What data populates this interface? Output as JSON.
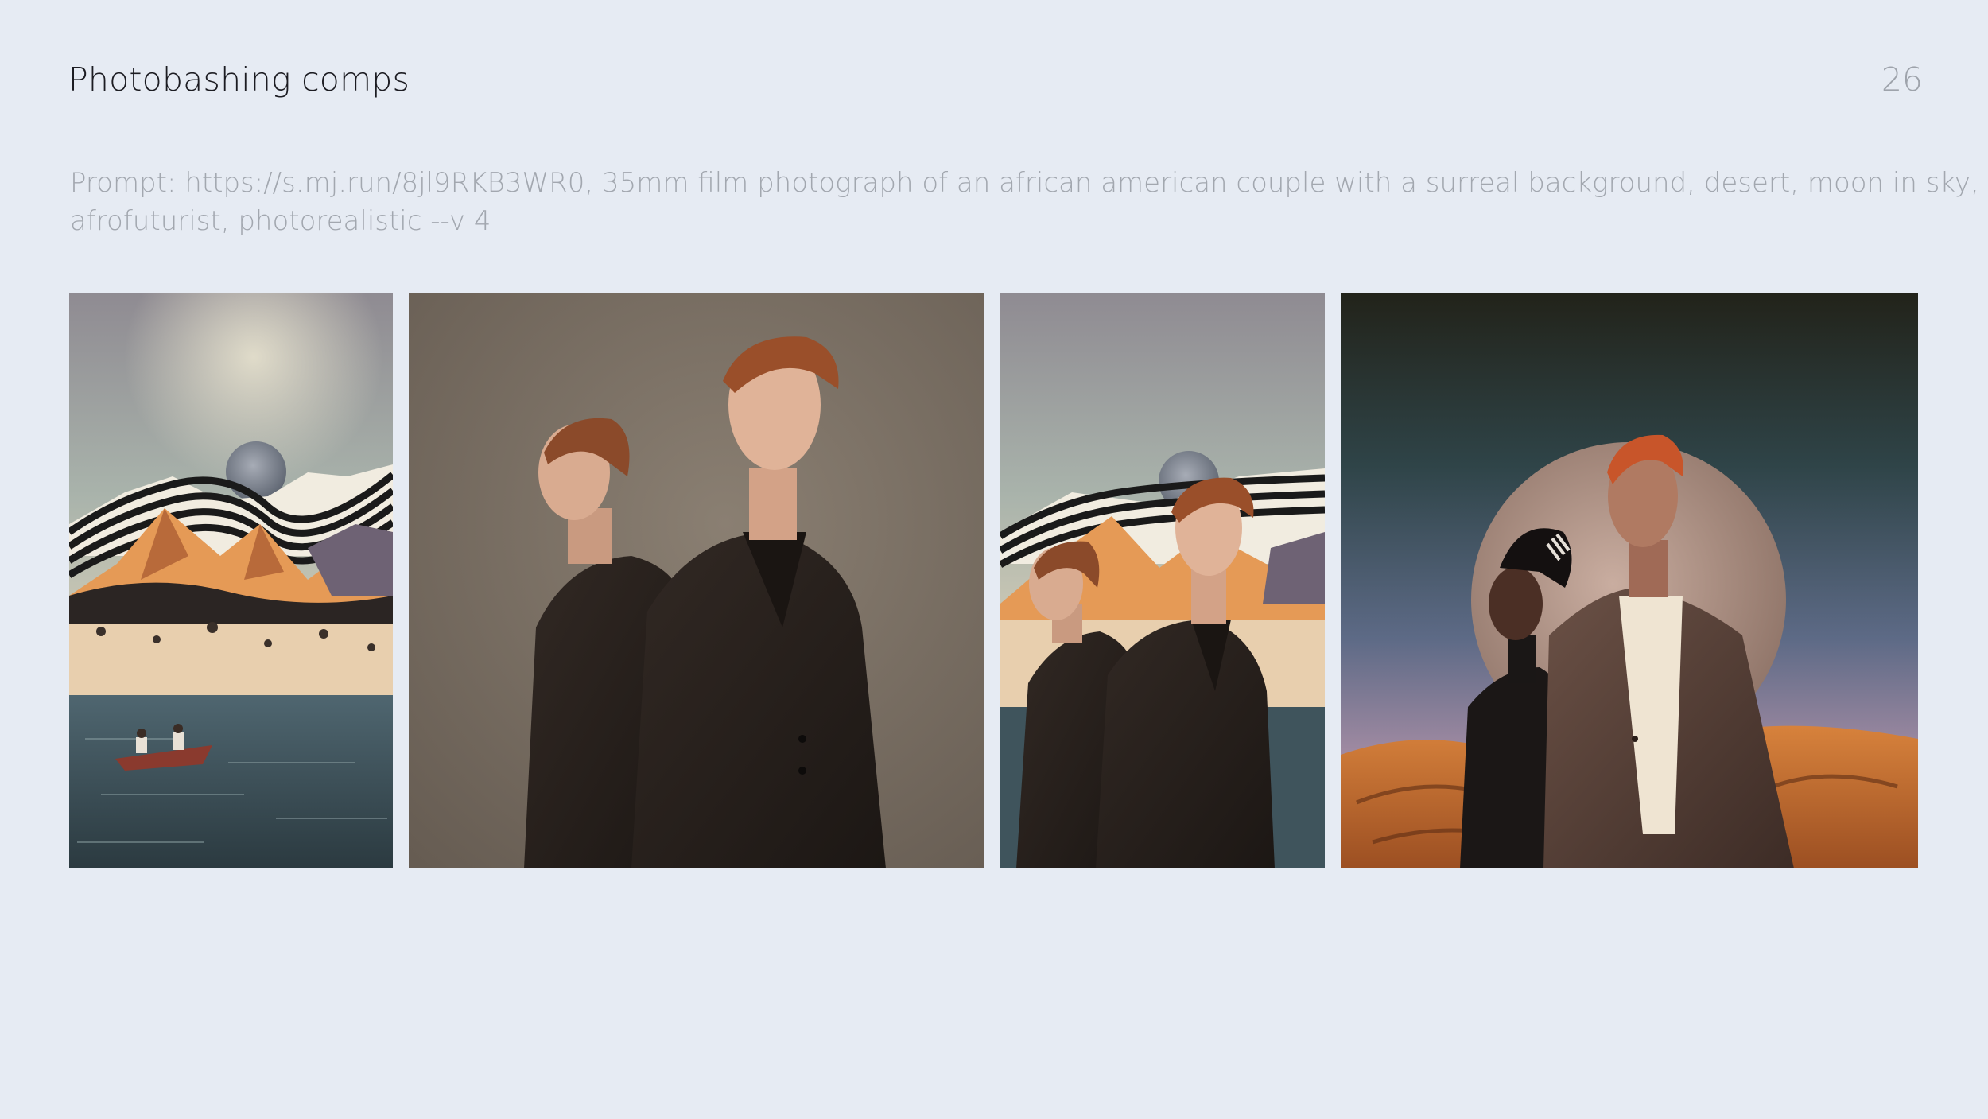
{
  "slide": {
    "title": "Photobashing comps",
    "page_number": "26",
    "prompt_line1": "Prompt: https://s.mj.run/8jl9RKB3WR0, 35mm film photograph of an african american couple with a surreal background, desert, moon in sky,",
    "prompt_line2": "afrofuturist, photorealistic --v 4"
  },
  "images": [
    {
      "name": "collage-landscape-moon-boat",
      "depicts": "vintage collage: moon over striped mountains, sandy peaks, lake with canoe"
    },
    {
      "name": "studio-portrait-two-men",
      "depicts": "two red-haired men in dark suits on a taupe studio background"
    },
    {
      "name": "photobash-comp-men-on-collage",
      "depicts": "the two men composited onto the collage landscape"
    },
    {
      "name": "afrofuturist-couple-desert-moon",
      "depicts": "couple in a desert with a large moon in the sky"
    }
  ],
  "colors": {
    "background": "#e6ebf3",
    "title": "#1c1c22",
    "muted_text": "#a2a7af"
  }
}
